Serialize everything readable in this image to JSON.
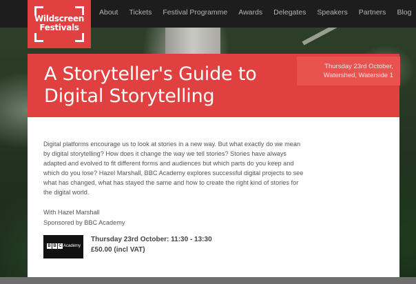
{
  "logo": {
    "line1": "Wildscreen",
    "line2": "Festivals"
  },
  "nav": {
    "items": [
      "About",
      "Tickets",
      "Festival Programme",
      "Awards",
      "Delegates",
      "Speakers",
      "Partners",
      "Blog"
    ]
  },
  "event": {
    "title": "A Storyteller's Guide to Digital Storytelling",
    "date_line1": "Thursday 23rd October,",
    "date_line2": "Watershed, Waterside 1",
    "description": "Digital platforms encourage us to look at stories in a new way. But what exactly do we mean by digital storytelling? How does it change the way we tell stories? Stories have always adapted and evolved to fit different forms and audiences but which parts do you keep and which do you lose? Hazel Marshall, BBC Academy explores successful digital projects to see what has changed, what has stayed the same and how to create the right kind of stories for the digital world.",
    "with": "With Hazel Marshall",
    "sponsor": "Sponsored by BBC Academy",
    "session_time": "Thursday 23rd October: 11:30 - 13:30",
    "session_price": "£50.00 (incl VAT)"
  },
  "sponsor_logo": {
    "letters": [
      "B",
      "B",
      "C"
    ],
    "text": "Academy"
  },
  "colors": {
    "brand_red": "#e0403f",
    "header_bg": "#1d1d1d"
  }
}
